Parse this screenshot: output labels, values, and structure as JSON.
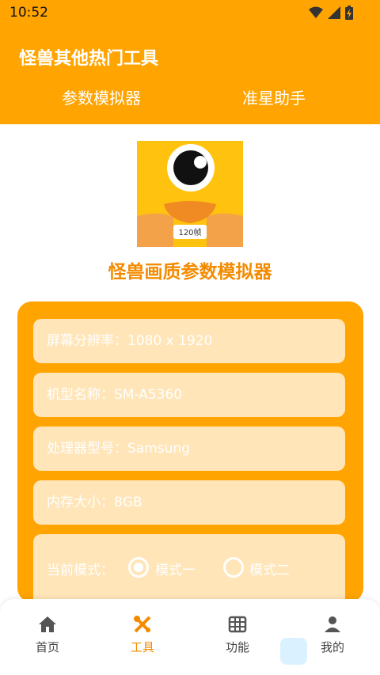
{
  "status_bar": {
    "time": "10:52"
  },
  "header": {
    "title": "怪兽其他热门工具",
    "tabs": [
      {
        "label": "参数模拟器"
      },
      {
        "label": "准星助手"
      }
    ]
  },
  "logo": {
    "badge_text": "120帧"
  },
  "main": {
    "title": "怪兽画质参数模拟器",
    "fields": [
      {
        "label": "屏幕分辨率：",
        "value": "1080 x 1920"
      },
      {
        "label": "机型名称：",
        "value": "SM-A5360"
      },
      {
        "label": "处理器型号：",
        "value": "Samsung"
      },
      {
        "label": "内存大小：",
        "value": "8GB"
      }
    ],
    "mode": {
      "label": "当前模式：",
      "options": [
        {
          "label": "模式一",
          "checked": true
        },
        {
          "label": "模式二",
          "checked": false
        }
      ]
    }
  },
  "bottom_nav": {
    "items": [
      {
        "label": "首页",
        "icon": "home-icon"
      },
      {
        "label": "工具",
        "icon": "tools-icon",
        "active": true
      },
      {
        "label": "功能",
        "icon": "grid-icon"
      },
      {
        "label": "我的",
        "icon": "person-icon"
      }
    ]
  },
  "colors": {
    "accent": "#ffa400",
    "title_orange": "#f38b00",
    "field_bg": "#ffe5b8"
  }
}
